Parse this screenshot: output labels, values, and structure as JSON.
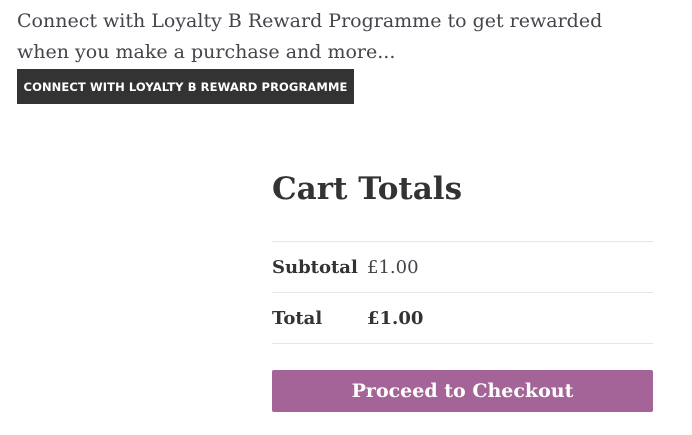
{
  "loyalty": {
    "message": "Connect with Loyalty B Reward Programme to get rewarded when you make a purchase and more...",
    "button_label": "CONNECT WITH LOYALTY B REWARD PROGRAMME"
  },
  "cart_totals": {
    "title": "Cart Totals",
    "rows": [
      {
        "label": "Subtotal",
        "value": "£1.00"
      },
      {
        "label": "Total",
        "value": "£1.00"
      }
    ],
    "checkout_label": "Proceed to Checkout"
  },
  "colors": {
    "checkout_button": "#a46497",
    "loyalty_button": "#333333",
    "text": "#43454b"
  }
}
